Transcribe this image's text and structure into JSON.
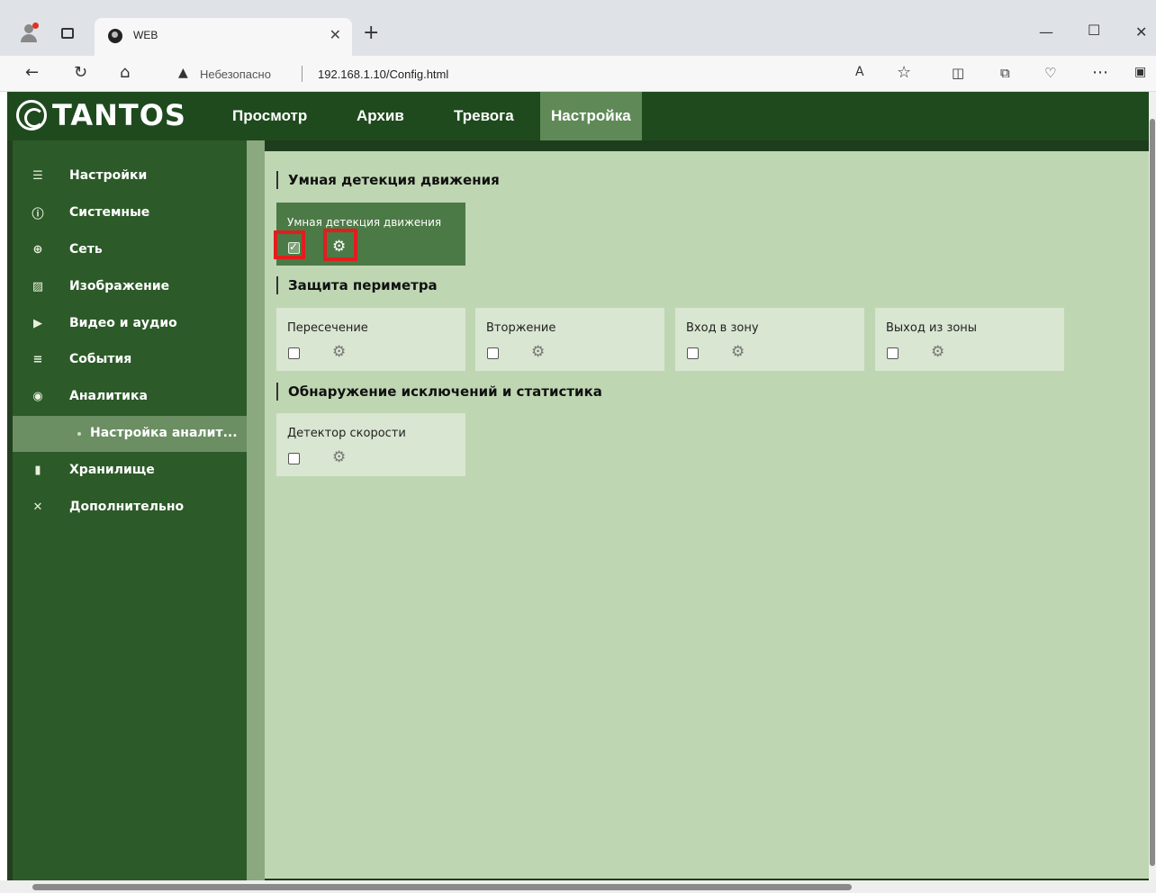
{
  "browser": {
    "tab_title": "WEB",
    "insecure_label": "Небезопасно",
    "url": "192.168.1.10/Config.html"
  },
  "app": {
    "logo": "TANTOS",
    "nav": [
      "Просмотр",
      "Архив",
      "Тревога",
      "Настройка"
    ],
    "active_nav": "Настройка"
  },
  "sidebar": {
    "items": [
      {
        "label": "Настройки",
        "icon": "list-icon"
      },
      {
        "label": "Системные",
        "icon": "info-icon"
      },
      {
        "label": "Сеть",
        "icon": "globe-icon"
      },
      {
        "label": "Изображение",
        "icon": "image-icon"
      },
      {
        "label": "Видео и аудио",
        "icon": "video-icon"
      },
      {
        "label": "События",
        "icon": "events-icon"
      },
      {
        "label": "Аналитика",
        "icon": "camera-icon"
      },
      {
        "label": "Настройка аналит...",
        "icon": "dot-icon"
      },
      {
        "label": "Хранилище",
        "icon": "storage-icon"
      },
      {
        "label": "Дополнительно",
        "icon": "tools-icon"
      }
    ]
  },
  "sections": {
    "smart_motion": {
      "title": "Умная детекция движения",
      "card": {
        "label": "Умная детекция движения",
        "checked": true
      }
    },
    "perimeter": {
      "title": "Защита периметра",
      "cards": [
        {
          "label": "Пересечение",
          "checked": false
        },
        {
          "label": "Вторжение",
          "checked": false
        },
        {
          "label": "Вход в зону",
          "checked": false
        },
        {
          "label": "Выход из зоны",
          "checked": false
        }
      ]
    },
    "exceptions": {
      "title": "Обнаружение исключений и статистика",
      "card": {
        "label": "Детектор скорости",
        "checked": false
      }
    }
  },
  "colors": {
    "accent_highlight": "#e01e1e",
    "nav_bg": "#1f4a1e",
    "sidebar_bg": "#2c5a28",
    "content_bg": "#bfd6b3"
  }
}
